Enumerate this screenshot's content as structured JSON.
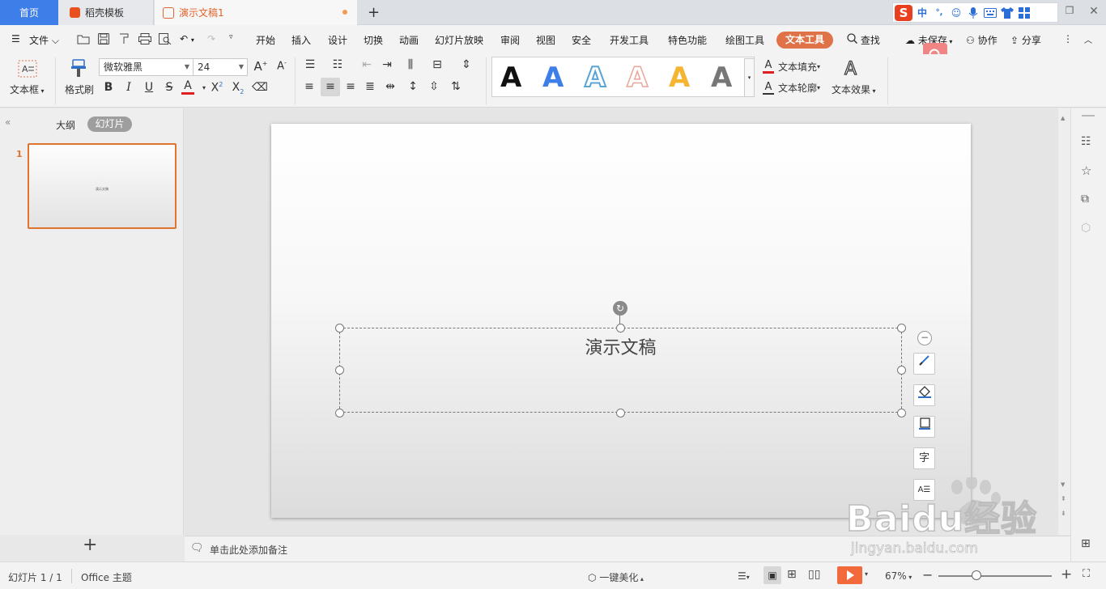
{
  "titlebar": {
    "tabs": [
      {
        "label": "首页"
      },
      {
        "label": "稻壳模板"
      },
      {
        "label": "演示文稿1"
      }
    ],
    "ime": {
      "lang": "中",
      "punct": "°,"
    }
  },
  "menu": {
    "file": "文件",
    "items": [
      "开始",
      "插入",
      "设计",
      "切换",
      "动画",
      "幻灯片放映",
      "审阅",
      "视图",
      "安全",
      "开发工具",
      "特色功能",
      "绘图工具",
      "文本工具"
    ],
    "search": "查找",
    "unsaved": "未保存",
    "collab": "协作",
    "share": "分享"
  },
  "ribbon": {
    "textbox": "文本框",
    "format_painter": "格式刷",
    "font_name": "微软雅黑",
    "font_size": "24",
    "text_fill": "文本填充",
    "text_outline": "文本轮廓",
    "text_effect": "文本效果",
    "wordart_colors": [
      "#111111",
      "#3d7ee8",
      "#5aa5d6",
      "#e8a79a",
      "#f5b431",
      "#777777"
    ]
  },
  "sidebar": {
    "tab_outline": "大纲",
    "tab_slides": "幻灯片",
    "slide_number": "1",
    "thumb_text": "演示文稿"
  },
  "slide": {
    "title": "演示文稿"
  },
  "float_tools": [
    "brush-icon",
    "shape-fill-icon",
    "outline-icon",
    "text-format-icon",
    "text-wrap-icon"
  ],
  "notes": {
    "placeholder": "单击此处添加备注"
  },
  "status": {
    "slide_info": "幻灯片 1 / 1",
    "theme": "Office 主题",
    "beautify": "一键美化",
    "zoom": "67%",
    "zoom_level": 0.67
  },
  "watermark": {
    "brand": "Baidu经验",
    "url": "jingyan.baidu.com"
  }
}
